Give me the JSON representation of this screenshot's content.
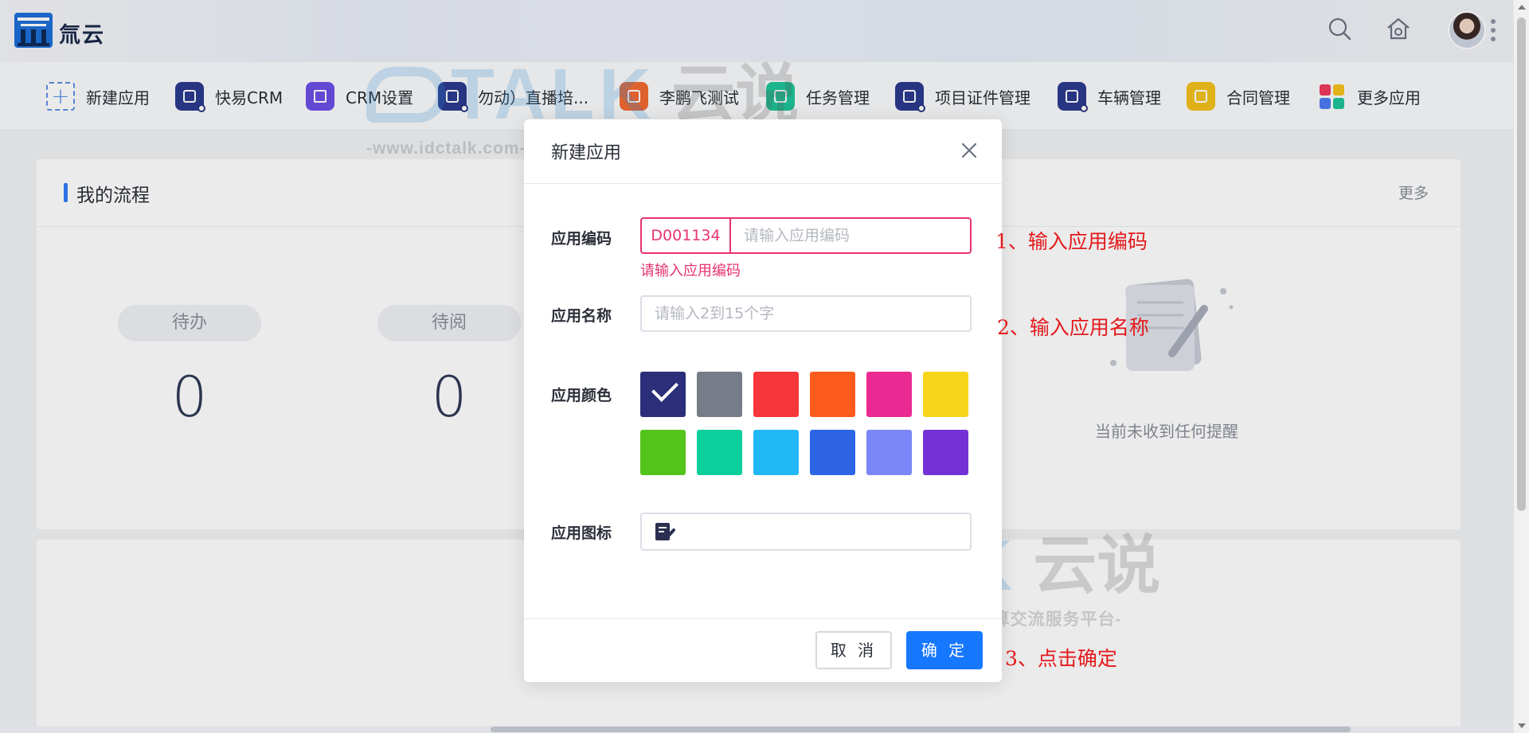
{
  "header": {
    "brand": "氚云",
    "icons": [
      "search-icon",
      "home-settings-icon"
    ]
  },
  "appbar": {
    "items": [
      {
        "label": "新建应用",
        "icon": "plus-icon",
        "color": "#ffffff"
      },
      {
        "label": "快易CRM",
        "icon": "crm-icon",
        "color": "#2b3a8f"
      },
      {
        "label": "CRM设置",
        "icon": "grid-settings-icon",
        "color": "#6c4fe6"
      },
      {
        "label": "勿动）直播培...",
        "icon": "presentation-icon",
        "color": "#2b3a8f"
      },
      {
        "label": "李鹏飞测试",
        "icon": "doc-icon",
        "color": "#f26b32"
      },
      {
        "label": "任务管理",
        "icon": "user-card-icon",
        "color": "#1fc49a"
      },
      {
        "label": "项目证件管理",
        "icon": "certificate-icon",
        "color": "#2b3a8f"
      },
      {
        "label": "车辆管理",
        "icon": "signpost-icon",
        "color": "#2b3a8f"
      },
      {
        "label": "合同管理",
        "icon": "layers-icon",
        "color": "#f2c11b"
      },
      {
        "label": "更多应用",
        "icon": "apps-grid-icon",
        "color": "#ffffff"
      }
    ]
  },
  "background": {
    "process_title": "我的流程",
    "more": "更多",
    "stats": [
      {
        "label": "待办",
        "value": "0"
      },
      {
        "label": "待阅",
        "value": "0"
      }
    ],
    "empty_text": "当前未收到任何提醒"
  },
  "watermark": {
    "brand_talk": "TALK",
    "brand_yun": "云说",
    "sub": "-www.idctalk.com-国内专业云计算交流服务平台-"
  },
  "modal": {
    "title": "新建应用",
    "code_label": "应用编码",
    "code_prefix": "D001134",
    "code_placeholder": "请输入应用编码",
    "code_error": "请输入应用编码",
    "name_label": "应用名称",
    "name_placeholder": "请输入2到15个字",
    "color_label": "应用颜色",
    "colors": [
      "#2b2f7a",
      "#767c88",
      "#f5363a",
      "#fd5a1e",
      "#ea2a92",
      "#f7d51b",
      "#52c41a",
      "#0ccf9c",
      "#22b8f7",
      "#2d64e6",
      "#7b86f8",
      "#7432d6"
    ],
    "selected_color_index": 0,
    "icon_label": "应用图标",
    "cancel": "取 消",
    "ok": "确 定"
  },
  "annotations": {
    "step1": "1、输入应用编码",
    "step2": "2、输入应用名称",
    "step3": "3、点击确定"
  }
}
